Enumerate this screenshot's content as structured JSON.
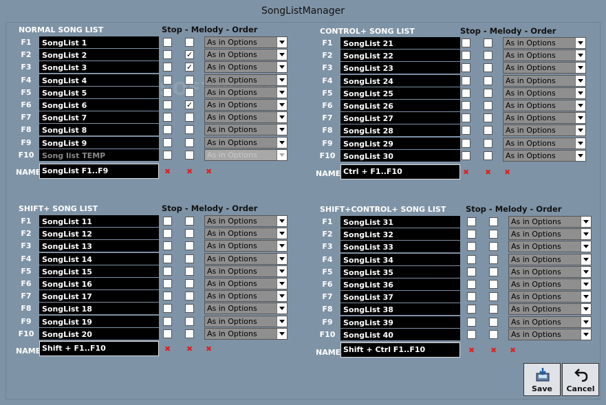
{
  "window": {
    "title": "SongListManager"
  },
  "option_header": "Stop - Melody - Order",
  "name_label": "NAME",
  "watermark": "SOFTPEDIA",
  "dropdown_value": "As in Options",
  "sections": [
    {
      "title": "NORMAL SONG LIST",
      "name_value": "SongList F1..F9",
      "rows": [
        {
          "key": "F1",
          "song": "SongList 1",
          "stop": false,
          "melody": false,
          "disabled": false
        },
        {
          "key": "F2",
          "song": "SongList 2",
          "stop": false,
          "melody": true,
          "disabled": false
        },
        {
          "key": "F3",
          "song": "SongList 3",
          "stop": false,
          "melody": true,
          "disabled": false
        },
        {
          "key": "F4",
          "song": "SongList 4",
          "stop": false,
          "melody": false,
          "disabled": false
        },
        {
          "key": "F5",
          "song": "SongList 5",
          "stop": false,
          "melody": false,
          "disabled": false
        },
        {
          "key": "F6",
          "song": "SongList 6",
          "stop": false,
          "melody": true,
          "disabled": false
        },
        {
          "key": "F7",
          "song": "SongList 7",
          "stop": false,
          "melody": false,
          "disabled": false
        },
        {
          "key": "F8",
          "song": "SongList 8",
          "stop": false,
          "melody": false,
          "disabled": false
        },
        {
          "key": "F9",
          "song": "SongList 9",
          "stop": false,
          "melody": false,
          "disabled": false
        },
        {
          "key": "F10",
          "song": "Song list TEMP",
          "stop": false,
          "melody": false,
          "disabled": true
        }
      ]
    },
    {
      "title": "CONTROL+  SONG LIST",
      "name_value": "Ctrl + F1..F10",
      "rows": [
        {
          "key": "F1",
          "song": "SongList 21",
          "stop": false,
          "melody": false,
          "disabled": false
        },
        {
          "key": "F2",
          "song": "SongList 22",
          "stop": false,
          "melody": false,
          "disabled": false
        },
        {
          "key": "F3",
          "song": "SongList 23",
          "stop": false,
          "melody": false,
          "disabled": false
        },
        {
          "key": "F4",
          "song": "SongList 24",
          "stop": false,
          "melody": false,
          "disabled": false
        },
        {
          "key": "F5",
          "song": "SongList 25",
          "stop": false,
          "melody": false,
          "disabled": false
        },
        {
          "key": "F6",
          "song": "SongList 26",
          "stop": false,
          "melody": false,
          "disabled": false
        },
        {
          "key": "F7",
          "song": "SongList 27",
          "stop": false,
          "melody": false,
          "disabled": false
        },
        {
          "key": "F8",
          "song": "SongList 28",
          "stop": false,
          "melody": false,
          "disabled": false
        },
        {
          "key": "F9",
          "song": "SongList 29",
          "stop": false,
          "melody": false,
          "disabled": false
        },
        {
          "key": "F10",
          "song": "SongList 30",
          "stop": false,
          "melody": false,
          "disabled": false
        }
      ]
    },
    {
      "title": "SHIFT+  SONG LIST",
      "name_value": "Shift + F1..F10",
      "rows": [
        {
          "key": "F1",
          "song": "SongList 11",
          "stop": false,
          "melody": false,
          "disabled": false
        },
        {
          "key": "F2",
          "song": "SongList 12",
          "stop": false,
          "melody": false,
          "disabled": false
        },
        {
          "key": "F3",
          "song": "SongList 13",
          "stop": false,
          "melody": false,
          "disabled": false
        },
        {
          "key": "F4",
          "song": "SongList 14",
          "stop": false,
          "melody": false,
          "disabled": false
        },
        {
          "key": "F5",
          "song": "SongList 15",
          "stop": false,
          "melody": false,
          "disabled": false
        },
        {
          "key": "F6",
          "song": "SongList 16",
          "stop": false,
          "melody": false,
          "disabled": false
        },
        {
          "key": "F7",
          "song": "SongList 17",
          "stop": false,
          "melody": false,
          "disabled": false
        },
        {
          "key": "F8",
          "song": "SongList 18",
          "stop": false,
          "melody": false,
          "disabled": false
        },
        {
          "key": "F9",
          "song": "SongList 19",
          "stop": false,
          "melody": false,
          "disabled": false
        },
        {
          "key": "F10",
          "song": "SongList 20",
          "stop": false,
          "melody": false,
          "disabled": false
        }
      ]
    },
    {
      "title": "SHIFT+CONTROL+  SONG LIST",
      "name_value": "Shift + Ctrl F1..F10",
      "rows": [
        {
          "key": "F1",
          "song": "SongList 31",
          "stop": false,
          "melody": false,
          "disabled": false
        },
        {
          "key": "F2",
          "song": "SongList 32",
          "stop": false,
          "melody": false,
          "disabled": false
        },
        {
          "key": "F3",
          "song": "SongList 33",
          "stop": false,
          "melody": false,
          "disabled": false
        },
        {
          "key": "F4",
          "song": "SongList 34",
          "stop": false,
          "melody": false,
          "disabled": false
        },
        {
          "key": "F5",
          "song": "SongList 35",
          "stop": false,
          "melody": false,
          "disabled": false
        },
        {
          "key": "F6",
          "song": "SongList 36",
          "stop": false,
          "melody": false,
          "disabled": false
        },
        {
          "key": "F7",
          "song": "SongList 37",
          "stop": false,
          "melody": false,
          "disabled": false
        },
        {
          "key": "F8",
          "song": "SongList 38",
          "stop": false,
          "melody": false,
          "disabled": false
        },
        {
          "key": "F9",
          "song": "SongList 39",
          "stop": false,
          "melody": false,
          "disabled": false
        },
        {
          "key": "F10",
          "song": "SongList 40",
          "stop": false,
          "melody": false,
          "disabled": false
        }
      ]
    }
  ],
  "buttons": {
    "save": "Save",
    "cancel": "Cancel"
  },
  "colors": {
    "background": "#7f93a6",
    "field": "#000000",
    "reset_mark": "#dd2222"
  }
}
